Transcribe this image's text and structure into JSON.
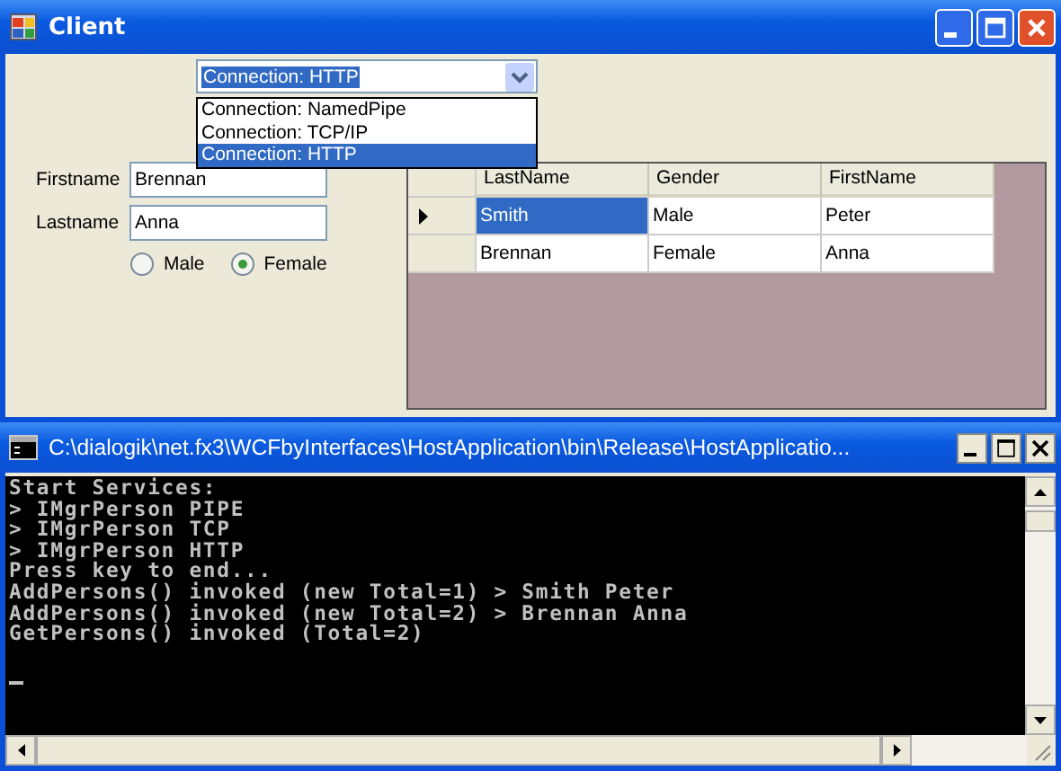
{
  "client": {
    "title": "Client",
    "connection": {
      "value": "Connection: HTTP",
      "expanded": true,
      "options": [
        {
          "label": "Connection: NamedPipe",
          "selected": false
        },
        {
          "label": "Connection: TCP/IP",
          "selected": false
        },
        {
          "label": "Connection: HTTP",
          "selected": true
        }
      ]
    },
    "fields": [
      {
        "label": "Firstname",
        "value": "Brennan"
      },
      {
        "label": "Lastname",
        "value": "Anna"
      }
    ],
    "gender": [
      {
        "label": "Male",
        "selected": false
      },
      {
        "label": "Female",
        "selected": true
      }
    ],
    "grid": {
      "columns": [
        "LastName",
        "Gender",
        "FirstName"
      ],
      "rows": [
        {
          "selected": true,
          "cells": [
            "Smith",
            "Male",
            "Peter"
          ]
        },
        {
          "selected": false,
          "cells": [
            "Brennan",
            "Female",
            "Anna"
          ]
        }
      ]
    }
  },
  "console": {
    "title": "C:\\dialogik\\net.fx3\\WCFbyInterfaces\\HostApplication\\bin\\Release\\HostApplicatio...",
    "lines": [
      "Start Services:",
      "> IMgrPerson PIPE",
      "> IMgrPerson TCP",
      "> IMgrPerson HTTP",
      "Press key to end...",
      "AddPersons() invoked (new Total=1) > Smith Peter",
      "AddPersons() invoked (new Total=2) > Brennan Anna",
      "GetPersons() invoked (Total=2)"
    ]
  }
}
